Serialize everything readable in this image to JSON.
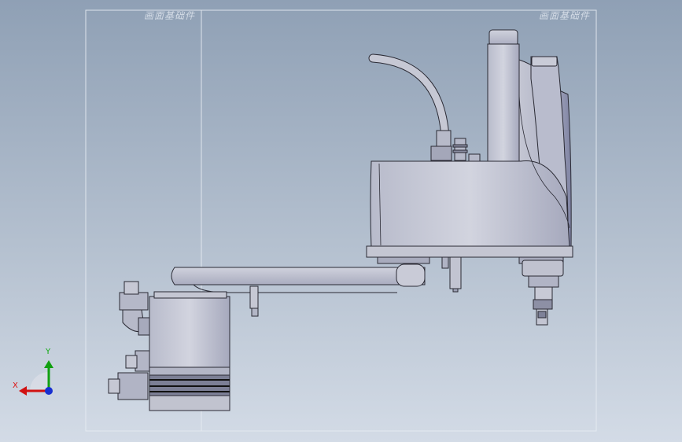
{
  "viewport": {
    "background_top": "#8fa0b5",
    "background_bottom": "#d3dbe6",
    "part_fill": "#c7c9d6",
    "part_shadow": "#9ea1b5",
    "edge_color": "#2a2a34"
  },
  "frame": {
    "left_label": "画面基础件",
    "right_label": "画面基础件"
  },
  "triad": {
    "x_label": "X",
    "y_label": "Y",
    "x_color": "#d11111",
    "y_color": "#11a011",
    "z_color": "#1830d0"
  }
}
